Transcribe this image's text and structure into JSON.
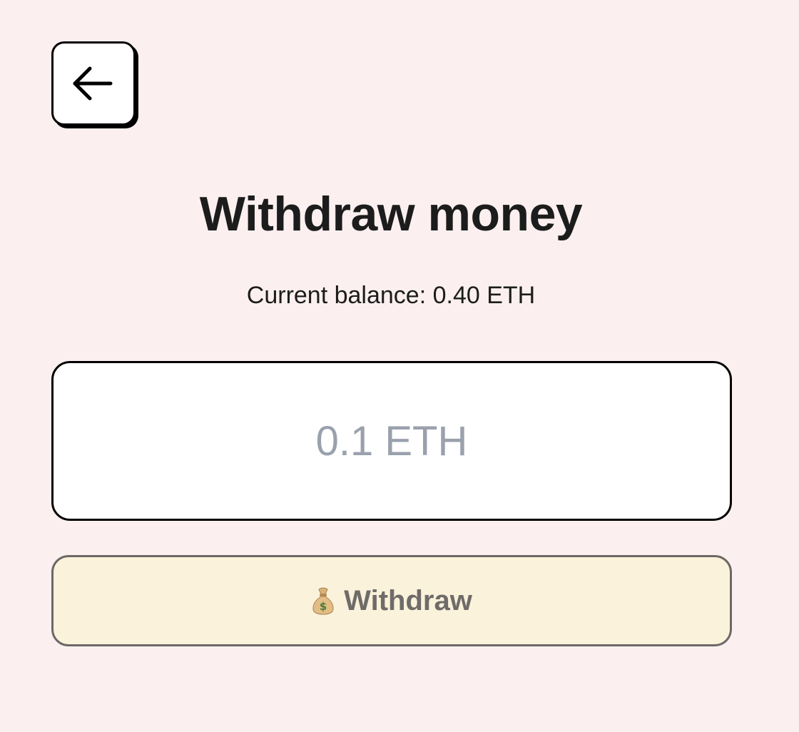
{
  "header": {
    "back_icon": "arrow-left-icon"
  },
  "page": {
    "title": "Withdraw money",
    "balance_text": "Current balance: 0.40 ETH"
  },
  "amount": {
    "value": "",
    "placeholder": "0.1 ETH"
  },
  "withdraw": {
    "icon": "money-bag-icon",
    "label": "Withdraw"
  },
  "colors": {
    "background": "#fbf0ef",
    "button_bg": "#fbf2db",
    "button_border": "#6c6866",
    "placeholder": "#9aa1ad",
    "text": "#1c1c1c"
  }
}
